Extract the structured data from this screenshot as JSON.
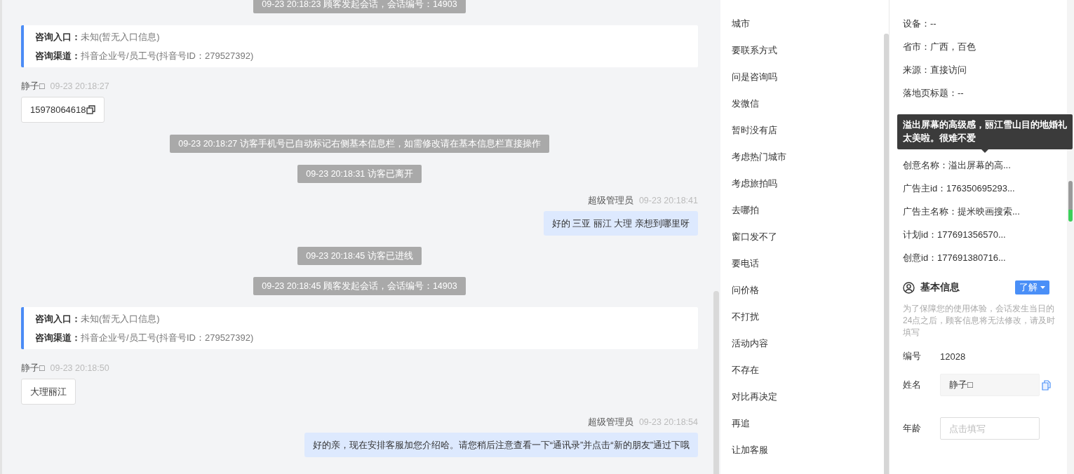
{
  "chat": {
    "messages": [
      {
        "kind": "system",
        "text": "09-23 20:18:23 顾客发起会话，会话编号：14903"
      },
      {
        "kind": "info",
        "rows": [
          {
            "label": "咨询入口：",
            "value": "未知(暂无入口信息)"
          },
          {
            "label": "咨询渠道：",
            "value": "抖音企业号/员工号(抖音号ID：279527392)"
          }
        ]
      },
      {
        "kind": "visitor",
        "name": "静子□",
        "time": "09-23 20:18:27",
        "text": "15978064618",
        "copyable": true
      },
      {
        "kind": "system",
        "text": "09-23 20:18:27 访客手机号已自动标记右侧基本信息栏，如需修改请在基本信息栏直接操作"
      },
      {
        "kind": "system",
        "text": "09-23 20:18:31 访客已离开"
      },
      {
        "kind": "agent",
        "name": "超级管理员",
        "time": "09-23 20:18:41",
        "text": "好的  三亚 丽江  大理 亲想到哪里呀"
      },
      {
        "kind": "system",
        "text": "09-23 20:18:45 访客已进线"
      },
      {
        "kind": "system",
        "text": "09-23 20:18:45 顾客发起会话，会话编号：14903"
      },
      {
        "kind": "info",
        "rows": [
          {
            "label": "咨询入口：",
            "value": "未知(暂无入口信息)"
          },
          {
            "label": "咨询渠道：",
            "value": "抖音企业号/员工号(抖音号ID：279527392)"
          }
        ]
      },
      {
        "kind": "visitor",
        "name": "静子□",
        "time": "09-23 20:18:50",
        "text": "大理丽江",
        "copyable": false
      },
      {
        "kind": "agent",
        "name": "超级管理员",
        "time": "09-23 20:18:54",
        "text": "好的亲，现在安排客服加您介绍哈。请您稍后注意查看一下“通讯录”并点击“新的朋友”通过下哦"
      }
    ]
  },
  "quick_replies": [
    "城市",
    "要联系方式",
    "问是咨询吗",
    "发微信",
    "暂时没有店",
    "考虑热门城市",
    "考虑旅拍吗",
    "去哪拍",
    "窗口发不了",
    "要电话",
    "问价格",
    "不打扰",
    "活动内容",
    "不存在",
    "对比再决定",
    "再追",
    "让加客服"
  ],
  "visit_info": {
    "rows": [
      {
        "kind": "field",
        "text": "设备：--"
      },
      {
        "kind": "field",
        "text": "省市：广西，百色"
      },
      {
        "kind": "field",
        "text": "来源：直接访问"
      },
      {
        "kind": "field",
        "text": "落地页标题：--"
      },
      {
        "kind": "tooltip",
        "text": "溢出屏幕的高级感，丽江雪山目的地婚礼太美啦。很难不爱"
      },
      {
        "kind": "field",
        "text": "创意名称：溢出屏幕的高..."
      },
      {
        "kind": "field",
        "text": "广告主id：176350695293..."
      },
      {
        "kind": "field",
        "text": "广告主名称：提米映画搜索..."
      },
      {
        "kind": "field",
        "text": "计划id：177691356570..."
      },
      {
        "kind": "field",
        "text": "创意id：177691380716..."
      }
    ]
  },
  "basic_info": {
    "title": "基本信息",
    "button": "了解",
    "notice": "为了保障您的使用体验，会话发生当日的24点之后，顾客信息将无法修改，请及时填写",
    "fields": [
      {
        "kind": "text",
        "label": "编号",
        "value": "12028"
      },
      {
        "kind": "input",
        "label": "姓名",
        "value": "静子□",
        "copy": true
      },
      {
        "kind": "input",
        "label": "年龄",
        "placeholder": "点击填写",
        "copy": false
      }
    ]
  }
}
